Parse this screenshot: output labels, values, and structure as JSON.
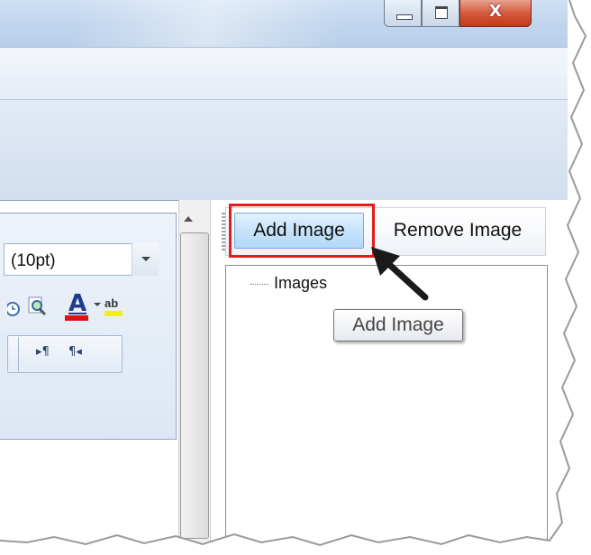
{
  "window": {
    "minimize_icon": "minimize-icon",
    "maximize_icon": "maximize-icon",
    "close_glyph": "X"
  },
  "editor": {
    "font_size": "(10pt)",
    "font_color_letter": "A",
    "highlight_label": "ab",
    "ltr_label": "▸¶",
    "rtl_label": "¶◂"
  },
  "images_panel": {
    "add_image_label": "Add Image",
    "remove_image_label": "Remove Image",
    "tree_root": "Images",
    "tooltip": "Add Image"
  },
  "colors": {
    "highlight_box": "#e21b1b",
    "font_color_bar": "#e01010",
    "button_hover": "#c6e3fb"
  }
}
